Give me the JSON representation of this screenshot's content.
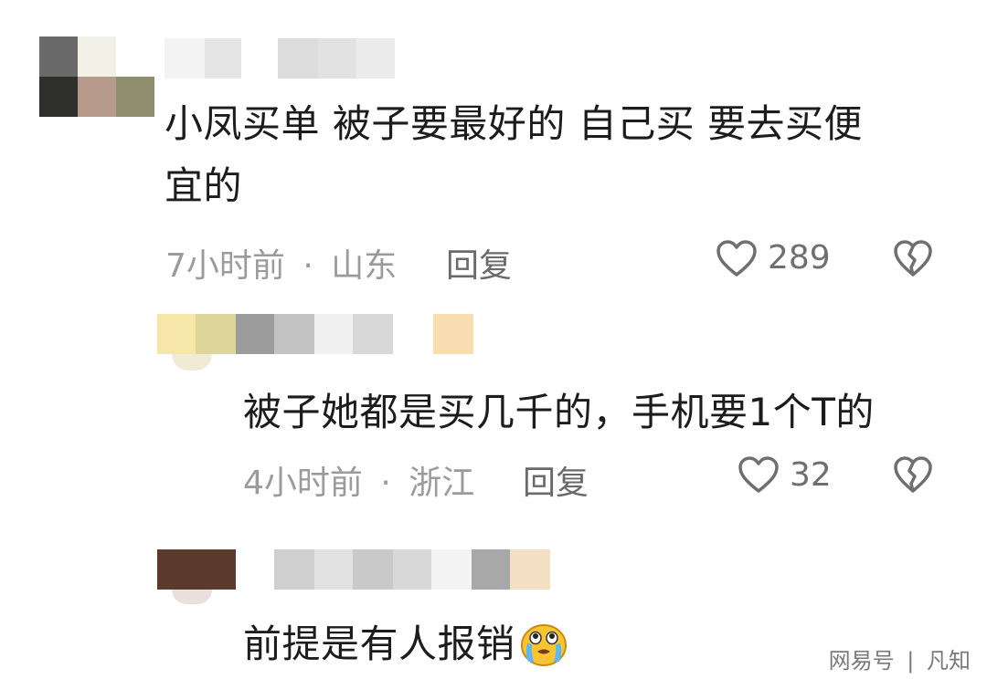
{
  "comments": [
    {
      "text_line1": "小凤买单 被子要最好的  自己买 要去买便",
      "text_line2": "宜的",
      "time": "7小时前",
      "location": "山东",
      "reply_label": "回复",
      "likes": "289"
    },
    {
      "text": "被子她都是买几千的，手机要1个T的",
      "time": "4小时前",
      "location": "浙江",
      "reply_label": "回复",
      "likes": "32"
    },
    {
      "text": "前提是有人报销"
    }
  ],
  "meta_separator": "·",
  "watermark": {
    "brand": "网易号",
    "divider": "|",
    "author": "凡知"
  },
  "icons": {
    "like": "heart-outline-icon",
    "dislike": "broken-heart-icon",
    "emoji": "crying-emoji-icon"
  },
  "colors": {
    "text": "#1c1c1c",
    "meta": "#9b9b9b",
    "icon": "#6f6f6f"
  }
}
